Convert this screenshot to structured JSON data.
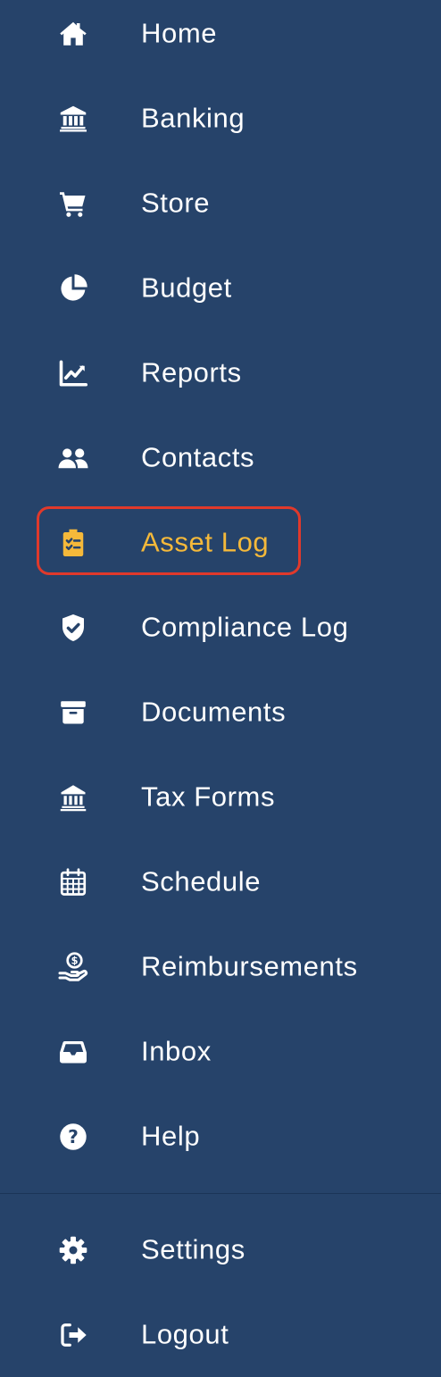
{
  "nav": {
    "items": [
      {
        "key": "home",
        "label": "Home",
        "icon": "home-icon"
      },
      {
        "key": "banking",
        "label": "Banking",
        "icon": "bank-icon"
      },
      {
        "key": "store",
        "label": "Store",
        "icon": "cart-icon"
      },
      {
        "key": "budget",
        "label": "Budget",
        "icon": "pie-chart-icon"
      },
      {
        "key": "reports",
        "label": "Reports",
        "icon": "line-chart-icon"
      },
      {
        "key": "contacts",
        "label": "Contacts",
        "icon": "users-icon"
      },
      {
        "key": "asset-log",
        "label": "Asset Log",
        "icon": "clipboard-check-icon",
        "active": true
      },
      {
        "key": "compliance-log",
        "label": "Compliance Log",
        "icon": "shield-check-icon"
      },
      {
        "key": "documents",
        "label": "Documents",
        "icon": "archive-box-icon"
      },
      {
        "key": "tax-forms",
        "label": "Tax Forms",
        "icon": "landmark-icon"
      },
      {
        "key": "schedule",
        "label": "Schedule",
        "icon": "calendar-icon"
      },
      {
        "key": "reimbursements",
        "label": "Reimbursements",
        "icon": "hand-dollar-icon"
      },
      {
        "key": "inbox",
        "label": "Inbox",
        "icon": "inbox-tray-icon"
      },
      {
        "key": "help",
        "label": "Help",
        "icon": "question-circle-icon"
      }
    ],
    "footer_items": [
      {
        "key": "settings",
        "label": "Settings",
        "icon": "gear-icon"
      },
      {
        "key": "logout",
        "label": "Logout",
        "icon": "logout-icon"
      }
    ]
  },
  "colors": {
    "background": "#26436a",
    "text": "#ffffff",
    "active": "#f5b93a",
    "highlight_border": "#e0392b"
  }
}
